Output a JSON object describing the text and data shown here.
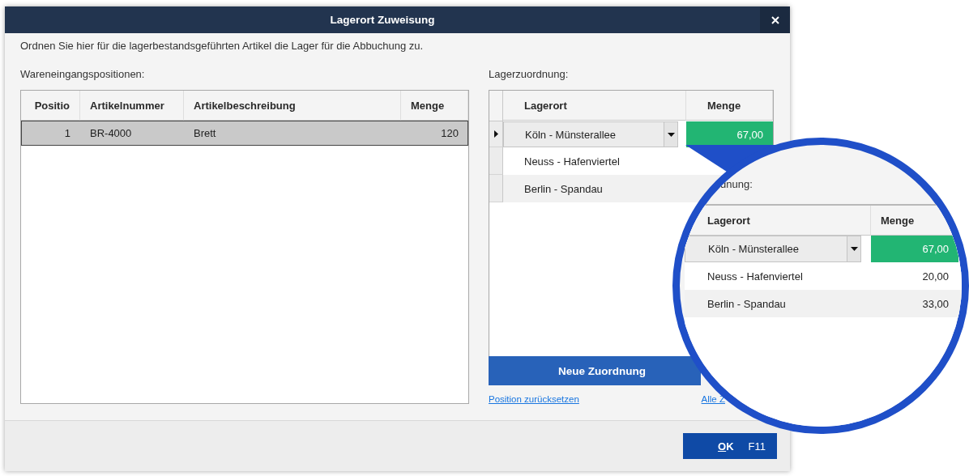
{
  "window": {
    "title": "Lagerort Zuweisung"
  },
  "intro": "Ordnen Sie hier für die lagerbestandsgeführten Artikel die Lager für die Abbuchung zu.",
  "receipt_positions": {
    "label": "Wareneingangspositionen:",
    "columns": [
      "Positio",
      "Artikelnummer",
      "Artikelbeschreibung",
      "Menge"
    ],
    "rows": [
      {
        "cells": [
          "1",
          "BR-4000",
          "Brett",
          "120"
        ],
        "selected": true
      }
    ]
  },
  "assignment": {
    "label": "Lagerzuordnung:",
    "columns": [
      "Lagerort",
      "Menge"
    ],
    "rows": [
      {
        "location": "Köln - Münsterallee",
        "quantity": "67,00",
        "selected": true
      },
      {
        "location": "Neuss - Hafenviertel",
        "selected": false
      },
      {
        "location": "Berlin - Spandau",
        "selected": false
      }
    ]
  },
  "new_button": "Neue Zuordnung",
  "links": [
    "Position zurücksetzen",
    "Alle Z"
  ],
  "ok_button": {
    "label": "OK",
    "shortcut": "F11"
  },
  "magnifier": {
    "label": "dnung:",
    "columns": [
      "Lagerort",
      "Menge"
    ],
    "rows": [
      {
        "location": "Köln - Münsterallee",
        "quantity": "67,00",
        "selected": true
      },
      {
        "location": "Neuss - Hafenviertel",
        "quantity": "20,00",
        "selected": false
      },
      {
        "location": "Berlin - Spandau",
        "quantity": "33,00",
        "selected": false
      }
    ]
  }
}
